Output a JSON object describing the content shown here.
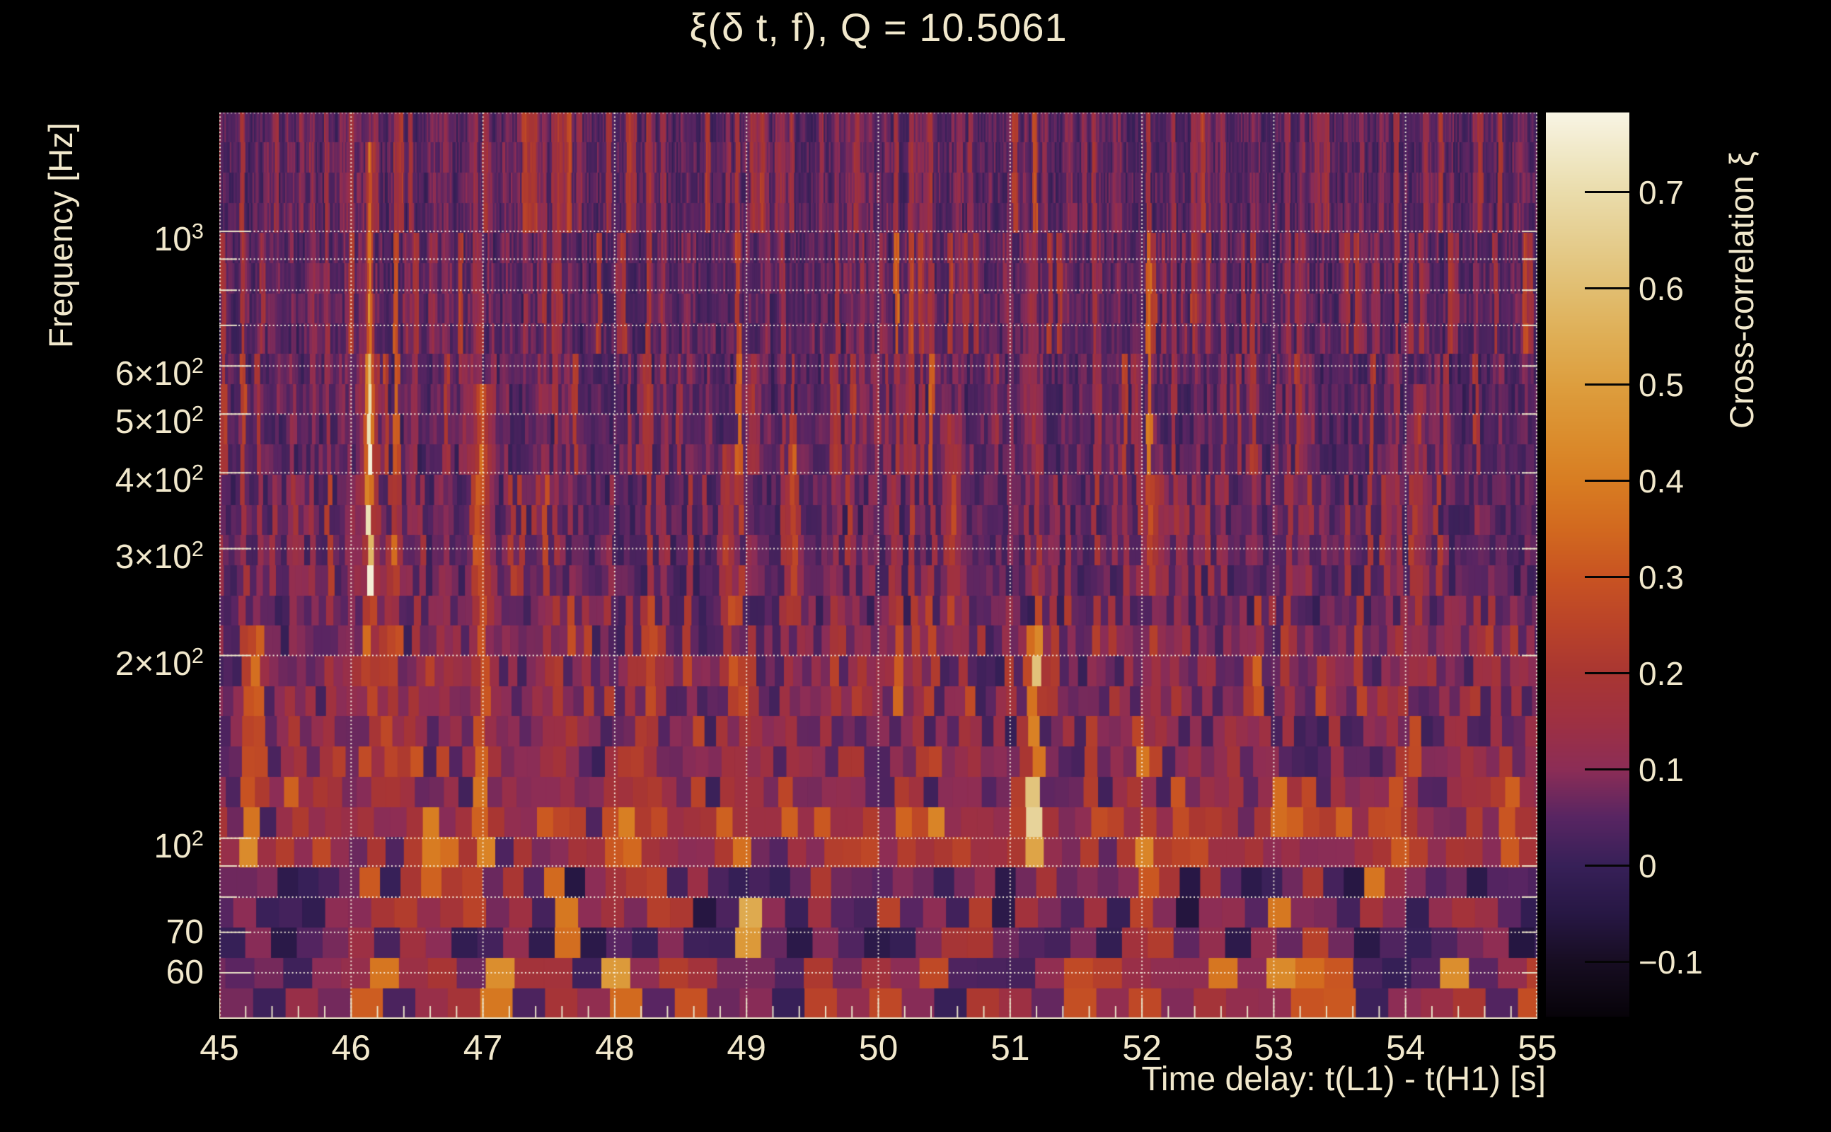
{
  "title": "ξ(δ t, f), Q = 10.5061",
  "colors": {
    "background": "#000000",
    "text_cream": "#f1e8cc",
    "grid_dots": "#faf5e4",
    "frame": "#e9e1c6",
    "colorbar_tick": "#050505"
  },
  "y_axis": {
    "label": "Frequency [Hz]",
    "ticks": [
      {
        "mant": "10",
        "exp": "3",
        "value": 1000
      },
      {
        "mant": "6×10",
        "exp": "2",
        "value": 600
      },
      {
        "mant": "5×10",
        "exp": "2",
        "value": 500
      },
      {
        "mant": "4×10",
        "exp": "2",
        "value": 400
      },
      {
        "mant": "3×10",
        "exp": "2",
        "value": 300
      },
      {
        "mant": "2×10",
        "exp": "2",
        "value": 200
      },
      {
        "mant": "10",
        "exp": "2",
        "value": 100
      },
      {
        "mant": "70",
        "exp": "",
        "value": 70
      },
      {
        "mant": "60",
        "exp": "",
        "value": 60
      }
    ]
  },
  "x_axis": {
    "label": "Time delay: t(L1) - t(H1) [s]",
    "ticks": [
      "45",
      "46",
      "47",
      "48",
      "49",
      "50",
      "51",
      "52",
      "53",
      "54",
      "55"
    ]
  },
  "colorbar": {
    "label": "Cross-correlation ξ",
    "ticks": [
      "0.7",
      "0.6",
      "0.5",
      "0.4",
      "0.3",
      "0.2",
      "0.1",
      "0",
      "−0.1"
    ]
  },
  "chart_data": {
    "type": "heatmap",
    "title": "ξ(δ t, f), Q = 10.5061",
    "q_value": 10.5061,
    "xlabel": "Time delay: t(L1) - t(H1) [s]",
    "ylabel": "Frequency [Hz]",
    "zlabel": "Cross-correlation ξ",
    "x_range_s": [
      45,
      55
    ],
    "x_major_ticks": [
      45,
      46,
      47,
      48,
      49,
      50,
      51,
      52,
      53,
      54,
      55
    ],
    "x_minor_step_s": 0.2,
    "y_scale": "log",
    "y_range_hz": [
      50.4,
      1570
    ],
    "y_tick_values_hz": [
      1000,
      600,
      500,
      400,
      300,
      200,
      100,
      70,
      60
    ],
    "y_gridline_values_hz": [
      1000,
      900,
      800,
      700,
      600,
      500,
      400,
      300,
      200,
      100,
      90,
      80,
      70,
      60
    ],
    "z_range": [
      -0.157,
      0.783
    ],
    "z_ticks": [
      0.7,
      0.6,
      0.5,
      0.4,
      0.3,
      0.2,
      0.1,
      0,
      -0.1
    ],
    "grid": "dotted, at every labeled/minor log frequency line and every integer second",
    "legend_position": "right colorbar",
    "colormap_stops": [
      {
        "v": -0.157,
        "c": "#070309"
      },
      {
        "v": -0.1,
        "c": "#170d22"
      },
      {
        "v": -0.05,
        "c": "#271744"
      },
      {
        "v": 0.0,
        "c": "#372058"
      },
      {
        "v": 0.05,
        "c": "#582562"
      },
      {
        "v": 0.1,
        "c": "#8c2d56"
      },
      {
        "v": 0.15,
        "c": "#9e3042"
      },
      {
        "v": 0.2,
        "c": "#a93632"
      },
      {
        "v": 0.25,
        "c": "#ba4329"
      },
      {
        "v": 0.3,
        "c": "#c85322"
      },
      {
        "v": 0.35,
        "c": "#d2691f"
      },
      {
        "v": 0.4,
        "c": "#d87d22"
      },
      {
        "v": 0.45,
        "c": "#db8e2e"
      },
      {
        "v": 0.5,
        "c": "#dd9e3e"
      },
      {
        "v": 0.55,
        "c": "#dfae55"
      },
      {
        "v": 0.6,
        "c": "#e1be71"
      },
      {
        "v": 0.65,
        "c": "#e5cd8e"
      },
      {
        "v": 0.7,
        "c": "#eadcab"
      },
      {
        "v": 0.74,
        "c": "#f0e8c6"
      },
      {
        "v": 0.783,
        "c": "#f8f4e4"
      }
    ],
    "background_level": {
      "mean": 0.04,
      "spread": 0.05
    },
    "bands": [
      {
        "f_lo_hz": 86,
        "f_hi_hz": 110,
        "boost": 0.055
      },
      {
        "f_lo_hz": 50,
        "f_hi_hz": 64,
        "boost": 0.035
      },
      {
        "f_lo_hz": 115,
        "f_hi_hz": 230,
        "boost": 0.02
      }
    ],
    "main_event": {
      "time_s": 46.14,
      "peak_xi": 0.78,
      "peak_freq_hz": 300
    },
    "hotspots": [
      {
        "t_s": 46.14,
        "f_lo_hz": 52,
        "f_hi_hz": 1350,
        "xi": 0.78,
        "main": true
      },
      {
        "t_s": 45.28,
        "f_lo_hz": 80,
        "f_hi_hz": 210,
        "xi": 0.3
      },
      {
        "t_s": 45.46,
        "f_lo_hz": 50,
        "f_hi_hz": 58,
        "xi": 0.38
      },
      {
        "t_s": 45.55,
        "f_lo_hz": 95,
        "f_hi_hz": 160,
        "xi": 0.22
      },
      {
        "t_s": 46.22,
        "f_lo_hz": 50,
        "f_hi_hz": 58,
        "xi": 0.42
      },
      {
        "t_s": 46.3,
        "f_lo_hz": 120,
        "f_hi_hz": 310,
        "xi": 0.18
      },
      {
        "t_s": 46.62,
        "f_lo_hz": 88,
        "f_hi_hz": 108,
        "xi": 0.3
      },
      {
        "t_s": 47.0,
        "f_lo_hz": 85,
        "f_hi_hz": 520,
        "xi": 0.26
      },
      {
        "t_s": 47.1,
        "f_lo_hz": 50,
        "f_hi_hz": 60,
        "xi": 0.3
      },
      {
        "t_s": 47.52,
        "f_lo_hz": 88,
        "f_hi_hz": 108,
        "xi": 0.24
      },
      {
        "t_s": 48.03,
        "f_lo_hz": 50,
        "f_hi_hz": 60,
        "xi": 0.3
      },
      {
        "t_s": 48.12,
        "f_lo_hz": 88,
        "f_hi_hz": 108,
        "xi": 0.26
      },
      {
        "t_s": 48.5,
        "f_lo_hz": 50,
        "f_hi_hz": 62,
        "xi": 0.34
      },
      {
        "t_s": 48.85,
        "f_lo_hz": 200,
        "f_hi_hz": 430,
        "xi": 0.18
      },
      {
        "t_s": 49.02,
        "f_lo_hz": 60,
        "f_hi_hz": 100,
        "xi": 0.32
      },
      {
        "t_s": 49.22,
        "f_lo_hz": 50,
        "f_hi_hz": 58,
        "xi": 0.3
      },
      {
        "t_s": 49.35,
        "f_lo_hz": 240,
        "f_hi_hz": 400,
        "xi": 0.2
      },
      {
        "t_s": 49.6,
        "f_lo_hz": 88,
        "f_hi_hz": 108,
        "xi": 0.26
      },
      {
        "t_s": 50.12,
        "f_lo_hz": 50,
        "f_hi_hz": 62,
        "xi": 0.3
      },
      {
        "t_s": 50.33,
        "f_lo_hz": 50,
        "f_hi_hz": 58,
        "xi": -0.14
      },
      {
        "t_s": 50.55,
        "f_lo_hz": 250,
        "f_hi_hz": 460,
        "xi": 0.16
      },
      {
        "t_s": 51.18,
        "f_lo_hz": 72,
        "f_hi_hz": 210,
        "xi": 0.4
      },
      {
        "t_s": 51.55,
        "f_lo_hz": 50,
        "f_hi_hz": 58,
        "xi": 0.28
      },
      {
        "t_s": 51.82,
        "f_lo_hz": 88,
        "f_hi_hz": 108,
        "xi": 0.28
      },
      {
        "t_s": 52.0,
        "f_lo_hz": 80,
        "f_hi_hz": 155,
        "xi": 0.32
      },
      {
        "t_s": 52.1,
        "f_lo_hz": 88,
        "f_hi_hz": 112,
        "xi": 0.26
      },
      {
        "t_s": 52.6,
        "f_lo_hz": 50,
        "f_hi_hz": 58,
        "xi": 0.26
      },
      {
        "t_s": 53.05,
        "f_lo_hz": 58,
        "f_hi_hz": 115,
        "xi": 0.32
      },
      {
        "t_s": 53.3,
        "f_lo_hz": 55,
        "f_hi_hz": 80,
        "xi": 0.22
      },
      {
        "t_s": 53.75,
        "f_lo_hz": 88,
        "f_hi_hz": 108,
        "xi": 0.26
      },
      {
        "t_s": 54.1,
        "f_lo_hz": 200,
        "f_hi_hz": 500,
        "xi": 0.14
      },
      {
        "t_s": 54.35,
        "f_lo_hz": 50,
        "f_hi_hz": 62,
        "xi": 0.28
      },
      {
        "t_s": 54.8,
        "f_lo_hz": 88,
        "f_hi_hz": 140,
        "xi": 0.24
      },
      {
        "t_s": 54.95,
        "f_lo_hz": 50,
        "f_hi_hz": 58,
        "xi": 0.3
      }
    ]
  }
}
